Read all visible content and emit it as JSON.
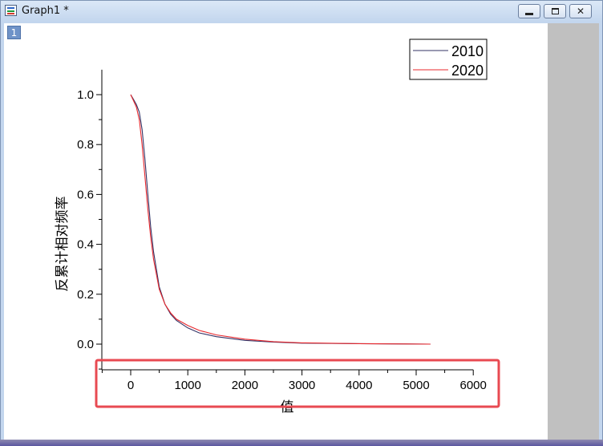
{
  "window": {
    "title": "Graph1 *",
    "layer_number": "1",
    "close_glyph": "✕"
  },
  "chart_data": {
    "type": "line",
    "xlabel": "值",
    "ylabel": "反累计相对频率",
    "xlim": [
      -500,
      6000
    ],
    "ylim": [
      -0.06,
      1.1
    ],
    "xticks": [
      0,
      1000,
      2000,
      3000,
      4000,
      5000,
      6000
    ],
    "xtick_labels": [
      "0",
      "1000",
      "2000",
      "3000",
      "4000",
      "5000",
      "6000"
    ],
    "yticks": [
      0.0,
      0.2,
      0.4,
      0.6,
      0.8,
      1.0
    ],
    "ytick_labels": [
      "0.0",
      "0.2",
      "0.4",
      "0.6",
      "0.8",
      "1.0"
    ],
    "legend_position": "top-right",
    "grid": false,
    "series": [
      {
        "name": "2010",
        "color": "#333366",
        "x": [
          0,
          50,
          100,
          150,
          200,
          250,
          300,
          350,
          400,
          500,
          600,
          700,
          800,
          1000,
          1200,
          1500,
          2000,
          2500,
          3000,
          4000,
          5250
        ],
        "y": [
          1.0,
          0.98,
          0.96,
          0.93,
          0.86,
          0.74,
          0.6,
          0.47,
          0.37,
          0.23,
          0.16,
          0.12,
          0.095,
          0.065,
          0.045,
          0.03,
          0.015,
          0.008,
          0.004,
          0.002,
          0.0
        ]
      },
      {
        "name": "2020",
        "color": "#e8282d",
        "x": [
          0,
          50,
          100,
          150,
          200,
          250,
          300,
          350,
          400,
          500,
          600,
          700,
          800,
          1000,
          1200,
          1500,
          2000,
          2500,
          3000,
          4000,
          5250
        ],
        "y": [
          1.0,
          0.975,
          0.95,
          0.9,
          0.8,
          0.67,
          0.54,
          0.43,
          0.34,
          0.22,
          0.16,
          0.125,
          0.1,
          0.075,
          0.055,
          0.037,
          0.02,
          0.01,
          0.005,
          0.002,
          0.0
        ]
      }
    ]
  },
  "highlight": {
    "color": "#e84a52"
  }
}
